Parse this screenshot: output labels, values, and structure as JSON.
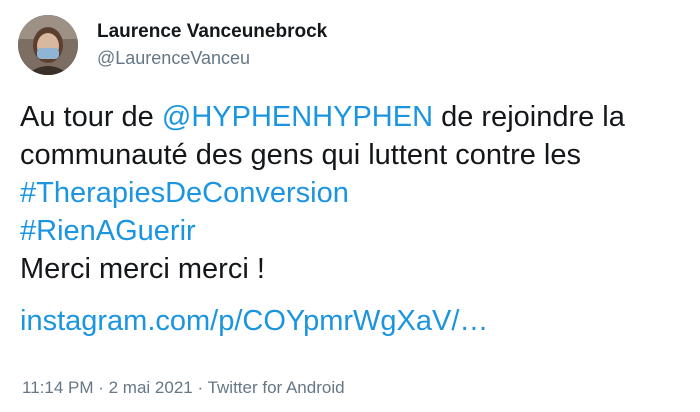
{
  "author": {
    "display_name": "Laurence Vanceunebrock",
    "handle": "@LaurenceVanceu"
  },
  "tweet": {
    "line1_prefix": "Au tour de ",
    "mention": "@HYPHENHYPHEN",
    "line1_suffix": " de rejoindre la",
    "line2": "communauté des gens qui luttent contre les",
    "hashtag1": "#TherapiesDeConversion",
    "hashtag2": "#RienAGuerir",
    "line5": "Merci merci merci !",
    "url": "instagram.com/p/COYpmrWgXaV/…"
  },
  "meta": {
    "time": "11:14 PM",
    "date": "2 mai 2021",
    "source": "Twitter for Android",
    "separator": " · "
  },
  "colors": {
    "link": "#1b95e0",
    "text": "#14171a",
    "muted": "#657786"
  }
}
